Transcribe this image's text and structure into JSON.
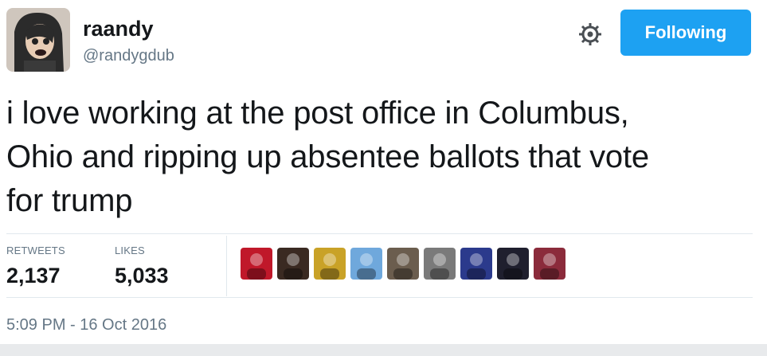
{
  "user": {
    "display_name": "raandy",
    "handle": "@randygdub"
  },
  "actions": {
    "settings_icon": "gear-icon",
    "follow_label": "Following"
  },
  "tweet": {
    "text": "i love working at the post office in Columbus,\nOhio and ripping up absentee ballots that vote\nfor trump",
    "timestamp": "5:09 PM - 16 Oct 2016"
  },
  "stats": {
    "retweets_label": "RETWEETS",
    "retweets_value": "2,137",
    "likes_label": "LIKES",
    "likes_value": "5,033"
  },
  "likers": [
    {
      "name": "liker-1",
      "color": "#c0182a"
    },
    {
      "name": "liker-2",
      "color": "#3a2a22"
    },
    {
      "name": "liker-3",
      "color": "#c9a227"
    },
    {
      "name": "liker-4",
      "color": "#6fa8dc"
    },
    {
      "name": "liker-5",
      "color": "#6b5d4e"
    },
    {
      "name": "liker-6",
      "color": "#7a7a7a"
    },
    {
      "name": "liker-7",
      "color": "#2b3a8c"
    },
    {
      "name": "liker-8",
      "color": "#1f1f2e"
    },
    {
      "name": "liker-9",
      "color": "#8b2b3b"
    }
  ],
  "colors": {
    "accent": "#1da1f2",
    "secondary_text": "#657786",
    "divider": "#e1e8ed"
  }
}
